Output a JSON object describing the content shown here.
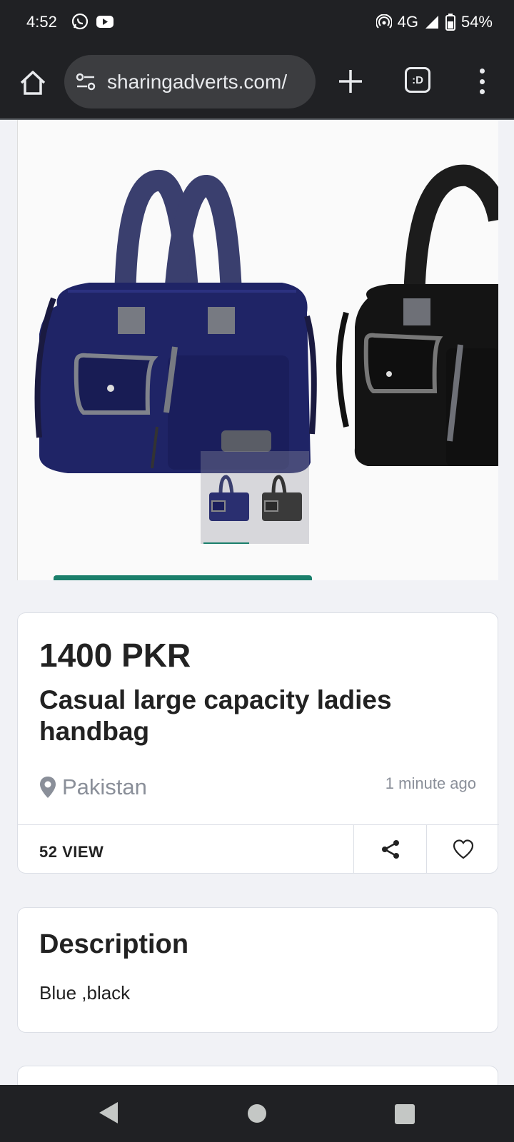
{
  "status_bar": {
    "time": "4:52",
    "network": "4G",
    "battery": "54%",
    "icons": [
      "whatsapp-icon",
      "youtube-icon",
      "hotspot-icon",
      "signal-icon",
      "battery-icon"
    ]
  },
  "browser": {
    "url": "sharingadverts.com/",
    "tab_count_label": ":D",
    "icons": [
      "home-icon",
      "tune-icon",
      "plus-icon",
      "tabs-icon",
      "more-vert-icon"
    ]
  },
  "listing": {
    "price": "1400 PKR",
    "title": "Casual large capacity ladies handbag",
    "location": "Pakistan",
    "posted": "1 minute ago",
    "views": "52 VIEW"
  },
  "description": {
    "heading": "Description",
    "text": "Blue ,black"
  },
  "colors": {
    "accent": "#1a7f6b",
    "bag_blue": "#1f2466",
    "bag_black": "#141414",
    "chrome_bg": "#202124"
  }
}
